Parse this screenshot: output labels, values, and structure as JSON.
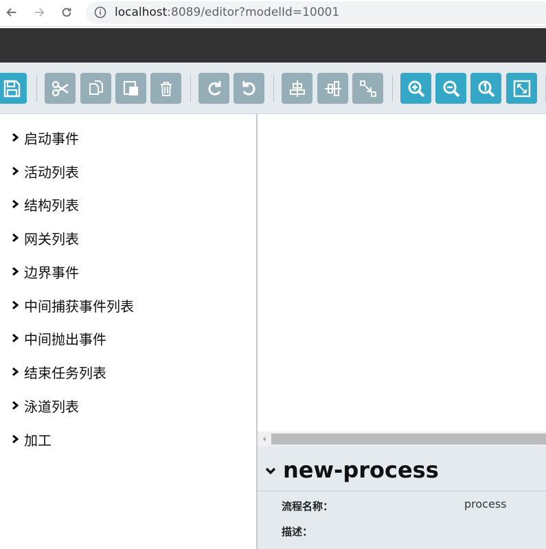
{
  "browser": {
    "url_host": "localhost",
    "url_path": ":8089/editor?modelId=10001"
  },
  "toolbar": {
    "buttons": [
      {
        "name": "save",
        "icon": "save-icon",
        "color": "blue"
      },
      {
        "name": "cut",
        "icon": "scissors-icon",
        "color": "gray"
      },
      {
        "name": "copy",
        "icon": "copy-icon",
        "color": "gray"
      },
      {
        "name": "paste",
        "icon": "paste-icon",
        "color": "gray"
      },
      {
        "name": "delete",
        "icon": "trash-icon",
        "color": "gray"
      },
      {
        "name": "redo",
        "icon": "redo-icon",
        "color": "gray"
      },
      {
        "name": "undo",
        "icon": "undo-icon",
        "color": "gray"
      },
      {
        "name": "align-vertical",
        "icon": "align-vertical-icon",
        "color": "gray"
      },
      {
        "name": "align-horizontal",
        "icon": "align-horizontal-icon",
        "color": "gray"
      },
      {
        "name": "same-size",
        "icon": "resize-icon",
        "color": "gray"
      },
      {
        "name": "zoom-in",
        "icon": "zoom-in-icon",
        "color": "blue"
      },
      {
        "name": "zoom-out",
        "icon": "zoom-out-icon",
        "color": "blue"
      },
      {
        "name": "zoom-actual",
        "icon": "zoom-actual-icon",
        "color": "blue"
      },
      {
        "name": "zoom-fit",
        "icon": "fit-screen-icon",
        "color": "blue"
      }
    ],
    "colors": {
      "gray": "#95aeb7",
      "blue": "#35a8c8",
      "background": "#e5eaee"
    }
  },
  "palette": {
    "items": [
      {
        "label": "启动事件"
      },
      {
        "label": "活动列表"
      },
      {
        "label": "结构列表"
      },
      {
        "label": "网关列表"
      },
      {
        "label": "边界事件"
      },
      {
        "label": "中间捕获事件列表"
      },
      {
        "label": "中间抛出事件"
      },
      {
        "label": "结束任务列表"
      },
      {
        "label": "泳道列表"
      },
      {
        "label": "加工"
      }
    ]
  },
  "properties": {
    "title": "new-process",
    "fields": [
      {
        "label": "流程名称：",
        "value": "process"
      },
      {
        "label": "描述：",
        "value": ""
      }
    ]
  }
}
